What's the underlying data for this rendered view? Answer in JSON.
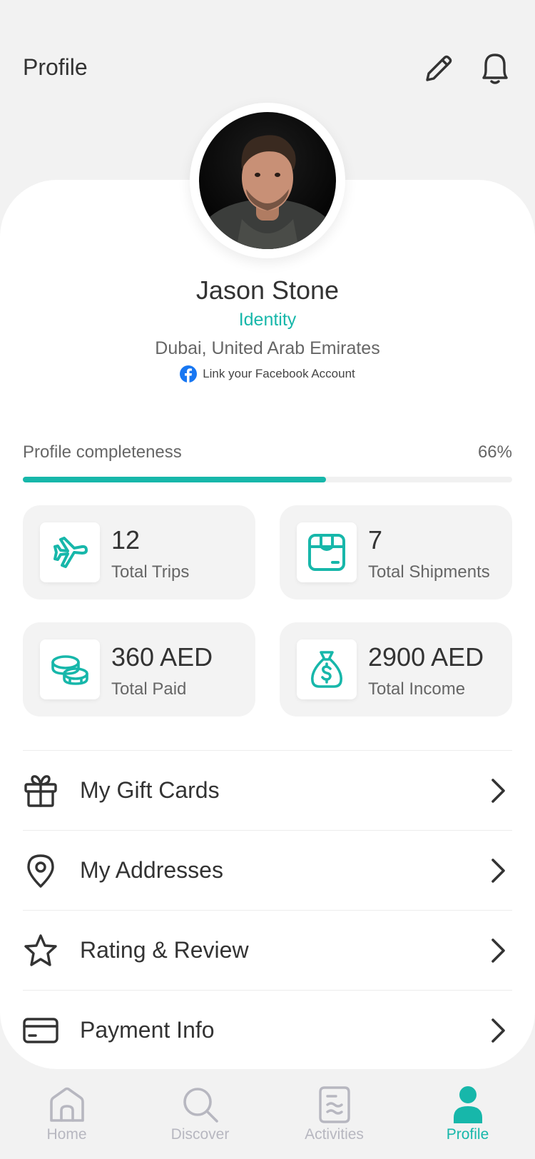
{
  "header": {
    "title": "Profile",
    "edit_icon": "pencil-icon",
    "notifications_icon": "bell-icon"
  },
  "profile": {
    "name": "Jason Stone",
    "identity": "Identity",
    "location": "Dubai, United Arab Emirates",
    "facebook_link": "Link your Facebook Account"
  },
  "completeness": {
    "label": "Profile completeness",
    "value_text": "66%",
    "fraction": 0.62
  },
  "stats": [
    {
      "value": "12",
      "label": "Total Trips",
      "icon": "airplane-icon"
    },
    {
      "value": "7",
      "label": "Total Shipments",
      "icon": "package-icon"
    },
    {
      "value": "360 AED",
      "label": "Total Paid",
      "icon": "coins-icon"
    },
    {
      "value": "2900 AED",
      "label": "Total Income",
      "icon": "money-bag-icon"
    }
  ],
  "menu": [
    {
      "label": "My Gift Cards",
      "icon": "gift-icon"
    },
    {
      "label": "My Addresses",
      "icon": "map-pin-icon"
    },
    {
      "label": "Rating & Review",
      "icon": "star-icon"
    },
    {
      "label": "Payment Info",
      "icon": "credit-card-icon"
    }
  ],
  "tabs": [
    {
      "label": "Home",
      "icon": "home-icon"
    },
    {
      "label": "Discover",
      "icon": "search-icon"
    },
    {
      "label": "Activities",
      "icon": "document-icon"
    },
    {
      "label": "Profile",
      "icon": "user-icon",
      "active": true
    }
  ],
  "colors": {
    "accent": "#17b7aa",
    "facebook": "#1877f2",
    "text": "#333333",
    "muted": "#b7b7c0"
  }
}
